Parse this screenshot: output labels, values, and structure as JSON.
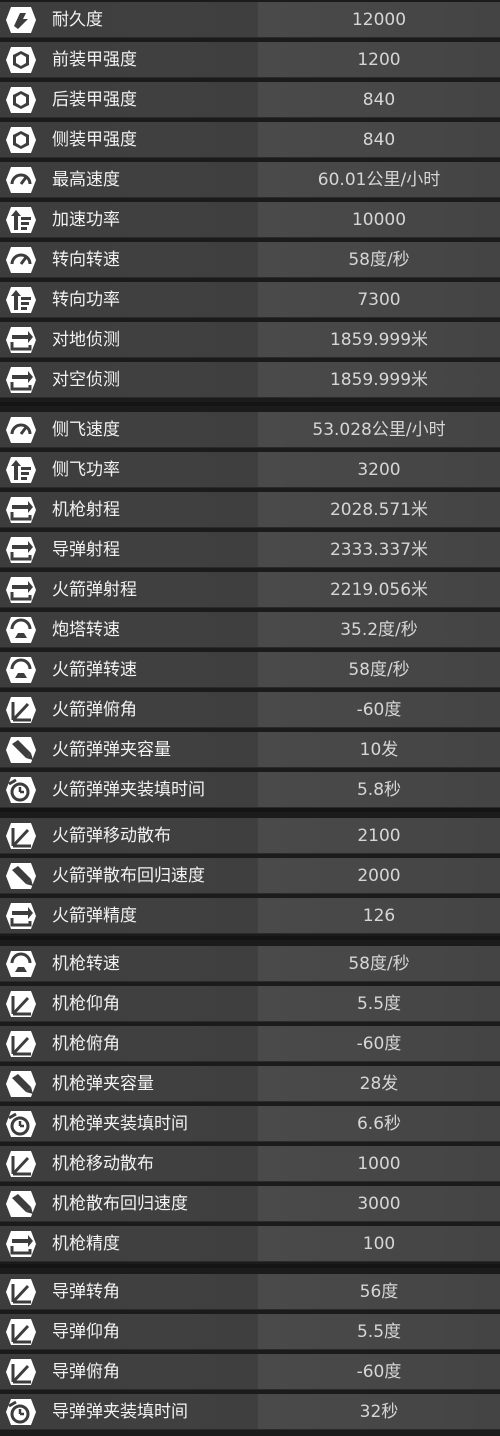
{
  "stats": [
    {
      "label": "耐久度",
      "value": "12000",
      "icon": "durability-icon"
    },
    {
      "label": "前装甲强度",
      "value": "1200",
      "icon": "armor-icon"
    },
    {
      "label": "后装甲强度",
      "value": "840",
      "icon": "armor-icon"
    },
    {
      "label": "侧装甲强度",
      "value": "840",
      "icon": "armor-icon"
    },
    {
      "label": "最高速度",
      "value": "60.01公里/小时",
      "icon": "speedometer-icon"
    },
    {
      "label": "加速功率",
      "value": "10000",
      "icon": "power-icon"
    },
    {
      "label": "转向转速",
      "value": "58度/秒",
      "icon": "speedometer-icon"
    },
    {
      "label": "转向功率",
      "value": "7300",
      "icon": "power-icon"
    },
    {
      "label": "对地侦测",
      "value": "1859.999米",
      "icon": "range-icon"
    },
    {
      "label": "对空侦测",
      "value": "1859.999米",
      "icon": "range-icon"
    },
    {
      "label": "侧飞速度",
      "value": "53.028公里/小时",
      "icon": "speedometer-icon"
    },
    {
      "label": "侧飞功率",
      "value": "3200",
      "icon": "power-icon"
    },
    {
      "label": "机枪射程",
      "value": "2028.571米",
      "icon": "range-icon"
    },
    {
      "label": "导弹射程",
      "value": "2333.337米",
      "icon": "range-icon"
    },
    {
      "label": "火箭弹射程",
      "value": "2219.056米",
      "icon": "range-icon"
    },
    {
      "label": "炮塔转速",
      "value": "35.2度/秒",
      "icon": "rotation-icon"
    },
    {
      "label": "火箭弹转速",
      "value": "58度/秒",
      "icon": "rotation-icon"
    },
    {
      "label": "火箭弹俯角",
      "value": "-60度",
      "icon": "angle-icon"
    },
    {
      "label": "火箭弹弹夹容量",
      "value": "10发",
      "icon": "ammo-icon"
    },
    {
      "label": "火箭弹弹夹装填时间",
      "value": "5.8秒",
      "icon": "reload-icon"
    },
    {
      "label": "火箭弹移动散布",
      "value": "2100",
      "icon": "angle-icon"
    },
    {
      "label": "火箭弹散布回归速度",
      "value": "2000",
      "icon": "ammo-icon"
    },
    {
      "label": "火箭弹精度",
      "value": "126",
      "icon": "range-icon"
    },
    {
      "label": "机枪转速",
      "value": "58度/秒",
      "icon": "rotation-icon"
    },
    {
      "label": "机枪仰角",
      "value": "5.5度",
      "icon": "angle-icon"
    },
    {
      "label": "机枪俯角",
      "value": "-60度",
      "icon": "angle-icon"
    },
    {
      "label": "机枪弹夹容量",
      "value": "28发",
      "icon": "ammo-icon"
    },
    {
      "label": "机枪弹夹装填时间",
      "value": "6.6秒",
      "icon": "reload-icon"
    },
    {
      "label": "机枪移动散布",
      "value": "1000",
      "icon": "angle-icon"
    },
    {
      "label": "机枪散布回归速度",
      "value": "3000",
      "icon": "ammo-icon"
    },
    {
      "label": "机枪精度",
      "value": "100",
      "icon": "range-icon"
    },
    {
      "label": "导弹转角",
      "value": "56度",
      "icon": "angle-icon"
    },
    {
      "label": "导弹仰角",
      "value": "5.5度",
      "icon": "angle-icon"
    },
    {
      "label": "导弹俯角",
      "value": "-60度",
      "icon": "angle-icon"
    },
    {
      "label": "导弹弹夹装填时间",
      "value": "32秒",
      "icon": "reload-icon"
    }
  ],
  "colors": {
    "row": "#3f3f3f",
    "value_bg": "#474747",
    "label": "#f2f2f2",
    "value": "#d6d6d6",
    "icon": "#ffffff"
  }
}
